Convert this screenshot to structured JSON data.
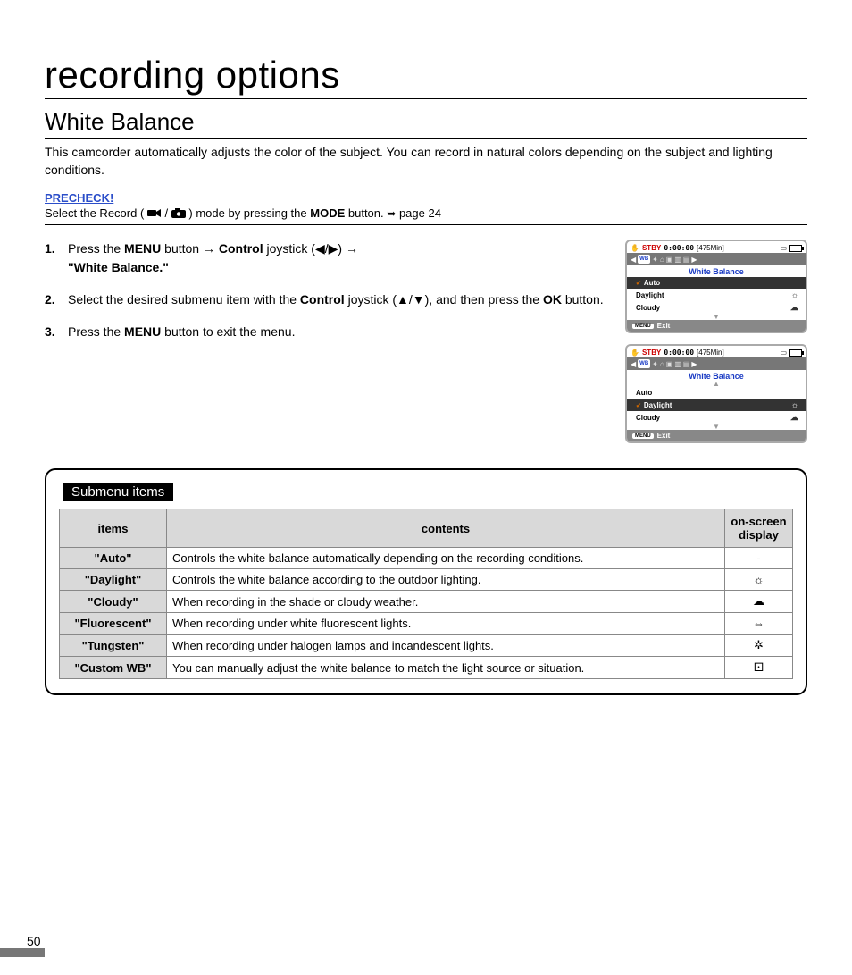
{
  "page": {
    "title": "recording options",
    "section": "White Balance",
    "intro": "This camcorder automatically adjusts the color of the subject. You can record in natural colors depending on the subject and lighting conditions.",
    "number": "50"
  },
  "precheck": {
    "label": "PRECHECK!",
    "prefix": "Select the Record (",
    "mid": " / ",
    "suffix_a": " ) mode by pressing the ",
    "mode_btn": "MODE",
    "suffix_b": " button. ",
    "page_ref": "page 24",
    "arrow": "➥"
  },
  "steps": {
    "s1_a": "Press the ",
    "s1_menu": "MENU",
    "s1_b": " button → ",
    "s1_control": "Control",
    "s1_c": " joystick (◀/▶) → ",
    "s1_wb": "\"White Balance.\"",
    "s2_a": "Select the desired submenu item with the ",
    "s2_control": "Control",
    "s2_b": " joystick (▲/▼), and then press the ",
    "s2_ok": "OK",
    "s2_c": " button.",
    "s3_a": "Press the ",
    "s3_menu": "MENU",
    "s3_b": " button to exit the menu."
  },
  "screen": {
    "stby": "STBY",
    "time": "0:00:00",
    "remain": "[475Min]",
    "heading": "White Balance",
    "footer_menu": "MENU",
    "footer_exit": "Exit",
    "wb_tab": "WB",
    "auto": "Auto",
    "daylight": "Daylight",
    "cloudy": "Cloudy",
    "icon_daylight": "☼",
    "icon_cloudy": "☁"
  },
  "table": {
    "label": "Submenu items",
    "head_items": "items",
    "head_contents": "contents",
    "head_display": "on-screen display",
    "rows": [
      {
        "item": "\"Auto\"",
        "content": "Controls the white balance automatically depending on the recording conditions.",
        "icon": "-"
      },
      {
        "item": "\"Daylight\"",
        "content": "Controls the white balance according to the outdoor lighting.",
        "icon": "☼"
      },
      {
        "item": "\"Cloudy\"",
        "content": "When recording in the shade or cloudy weather.",
        "icon": "☁"
      },
      {
        "item": "\"Fluorescent\"",
        "content": "When recording under white fluorescent lights.",
        "icon": "⇔"
      },
      {
        "item": "\"Tungsten\"",
        "content": "When recording under halogen lamps and incandescent lights.",
        "icon": "✲"
      },
      {
        "item": "\"Custom WB\"",
        "content": "You can manually adjust the white balance to match the light source or situation.",
        "icon": "⚀"
      }
    ]
  }
}
